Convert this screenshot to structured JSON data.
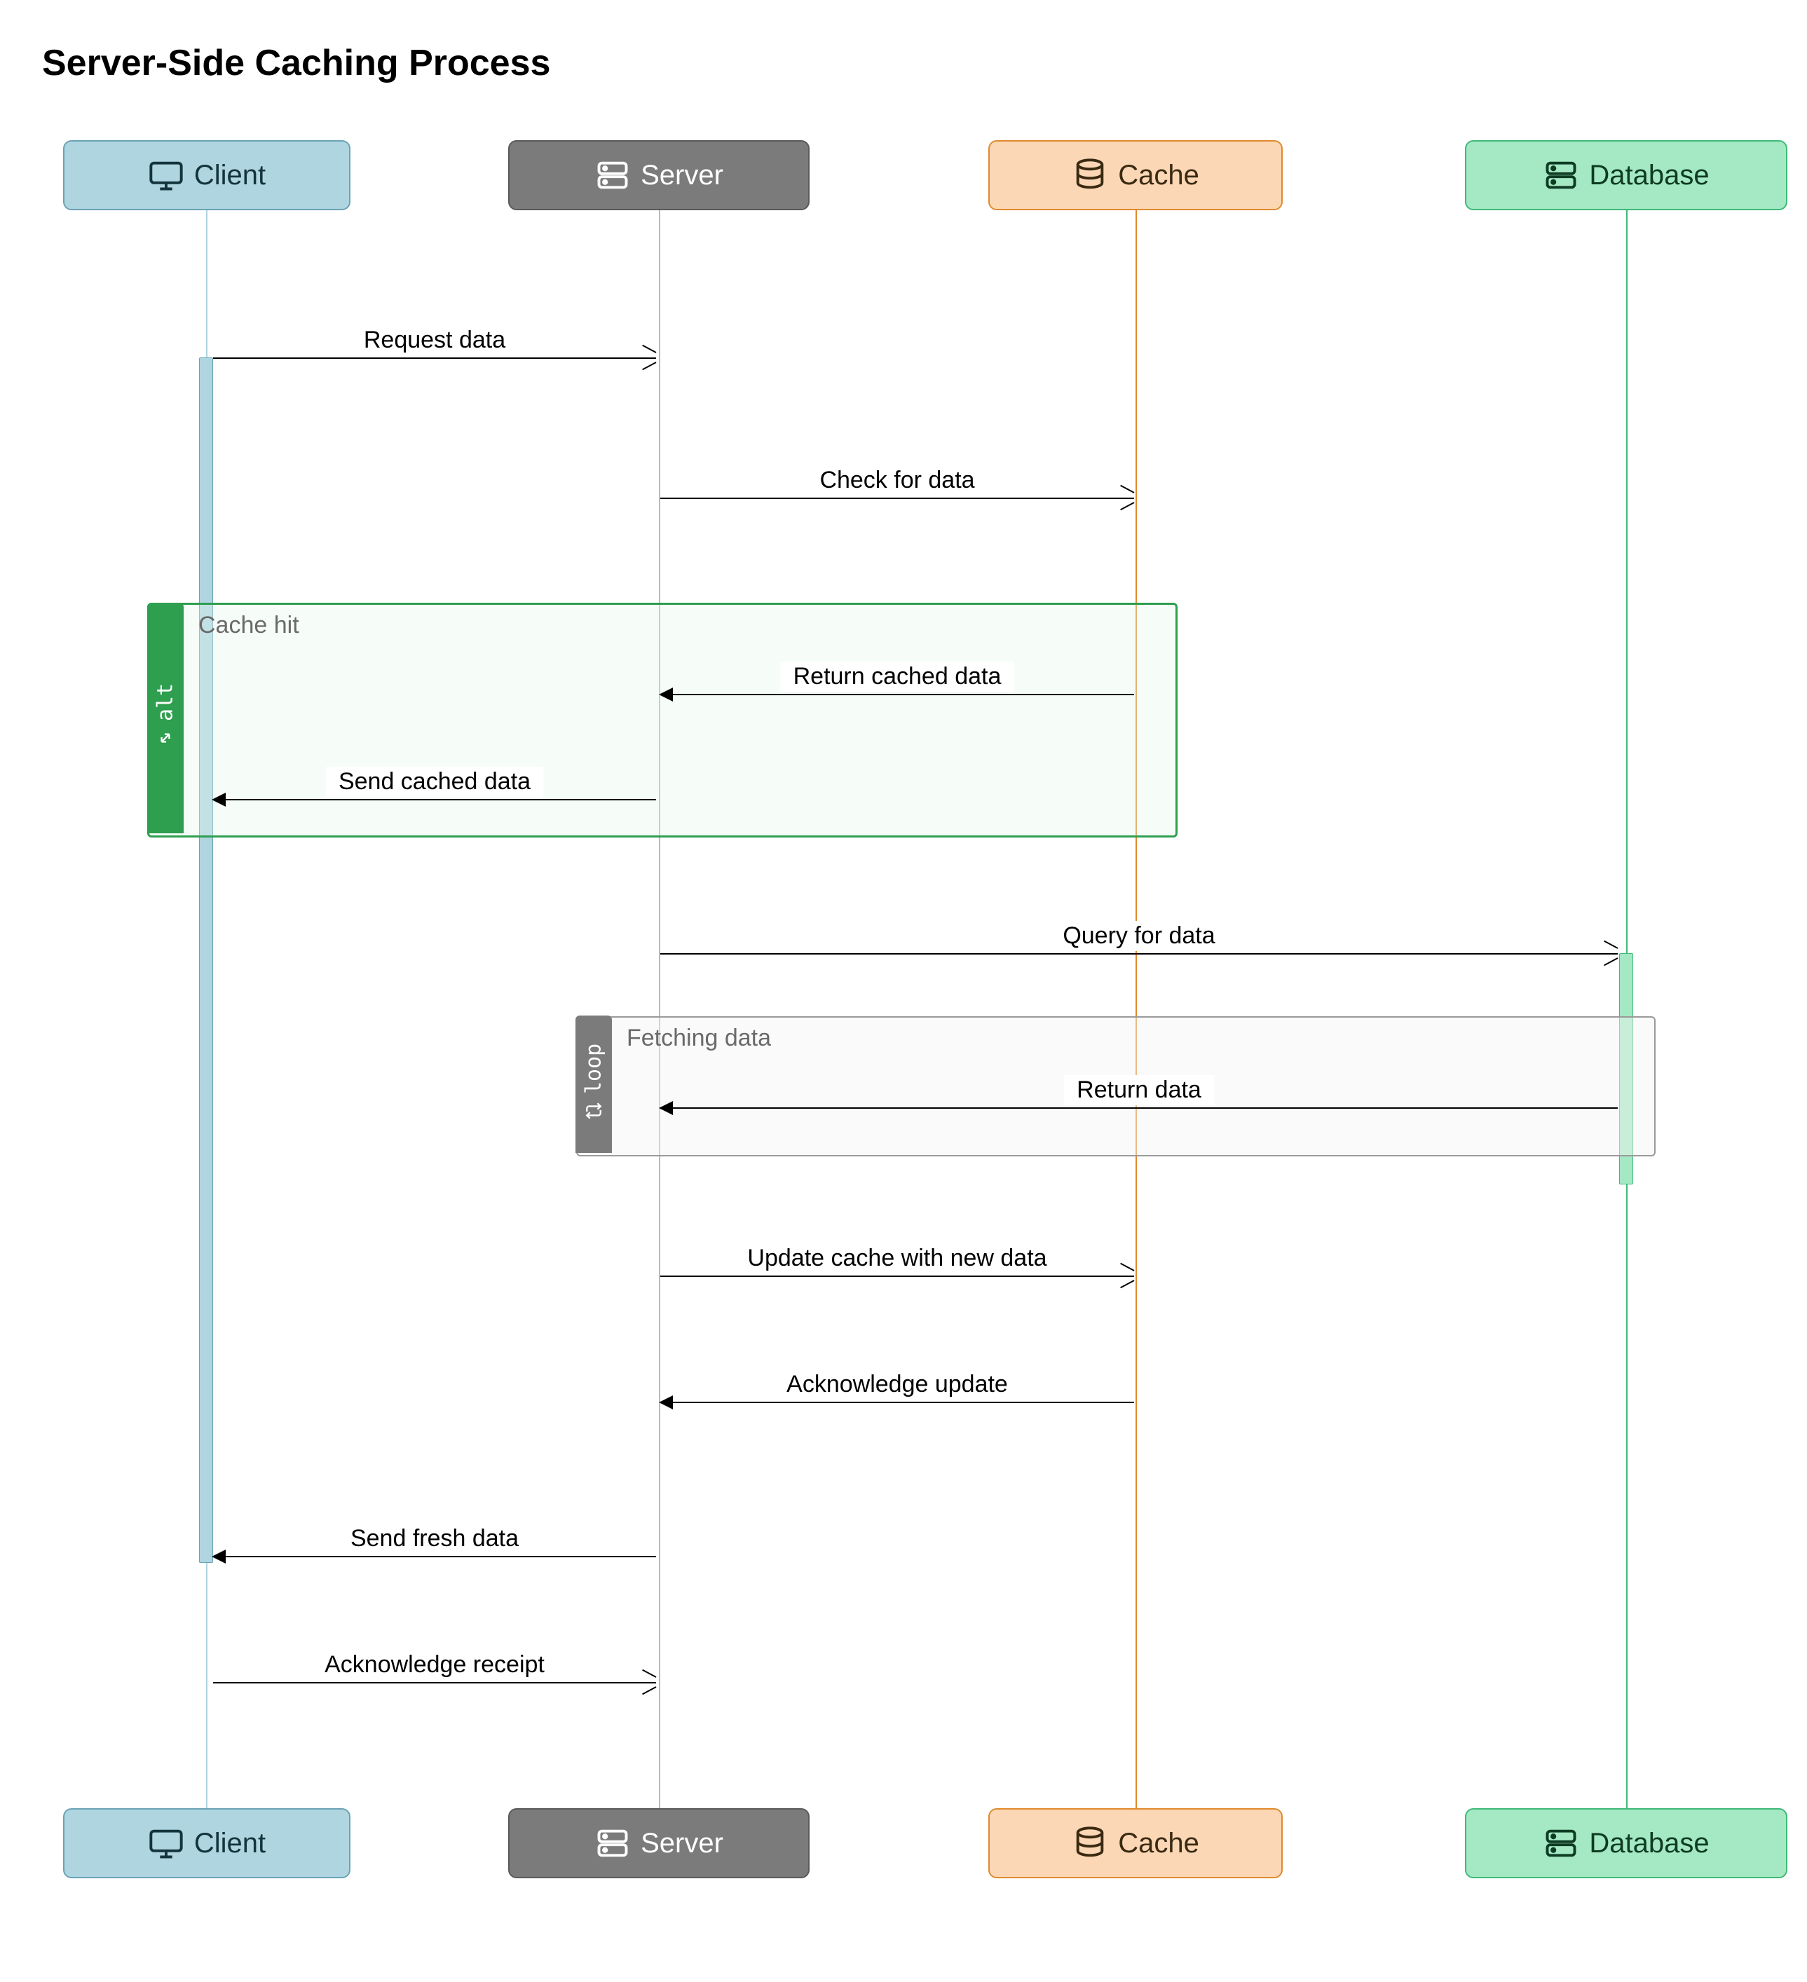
{
  "title": "Server-Side Caching Process",
  "participants": {
    "client": {
      "label": "Client",
      "icon": "monitor"
    },
    "server": {
      "label": "Server",
      "icon": "server-rack"
    },
    "cache": {
      "label": "Cache",
      "icon": "database"
    },
    "database": {
      "label": "Database",
      "icon": "server-rack"
    }
  },
  "fragments": {
    "alt": {
      "tag": "alt",
      "condition": "Cache hit",
      "icon": "expand-arrows"
    },
    "loop": {
      "tag": "loop",
      "condition": "Fetching data",
      "icon": "loop-arrows"
    }
  },
  "messages": {
    "m1": {
      "from": "client",
      "to": "server",
      "text": "Request data",
      "style": "open"
    },
    "m2": {
      "from": "server",
      "to": "cache",
      "text": "Check for data",
      "style": "open"
    },
    "m3": {
      "from": "cache",
      "to": "server",
      "text": "Return cached data",
      "style": "solid"
    },
    "m4": {
      "from": "server",
      "to": "client",
      "text": "Send cached data",
      "style": "solid"
    },
    "m5": {
      "from": "server",
      "to": "database",
      "text": "Query for data",
      "style": "open"
    },
    "m6": {
      "from": "database",
      "to": "server",
      "text": "Return data",
      "style": "solid"
    },
    "m7": {
      "from": "server",
      "to": "cache",
      "text": "Update cache with new data",
      "style": "open"
    },
    "m8": {
      "from": "cache",
      "to": "server",
      "text": "Acknowledge update",
      "style": "solid"
    },
    "m9": {
      "from": "server",
      "to": "client",
      "text": "Send fresh data",
      "style": "solid"
    },
    "m10": {
      "from": "client",
      "to": "server",
      "text": "Acknowledge receipt",
      "style": "open"
    }
  },
  "chart_data": {
    "type": "sequence-diagram",
    "title": "Server-Side Caching Process",
    "participants": [
      "Client",
      "Server",
      "Cache",
      "Database"
    ],
    "interactions": [
      {
        "from": "Client",
        "to": "Server",
        "label": "Request data"
      },
      {
        "from": "Server",
        "to": "Cache",
        "label": "Check for data"
      },
      {
        "fragment": "alt",
        "condition": "Cache hit",
        "messages": [
          {
            "from": "Cache",
            "to": "Server",
            "label": "Return cached data"
          },
          {
            "from": "Server",
            "to": "Client",
            "label": "Send cached data"
          }
        ]
      },
      {
        "from": "Server",
        "to": "Database",
        "label": "Query for data"
      },
      {
        "fragment": "loop",
        "condition": "Fetching data",
        "messages": [
          {
            "from": "Database",
            "to": "Server",
            "label": "Return data"
          }
        ]
      },
      {
        "from": "Server",
        "to": "Cache",
        "label": "Update cache with new data"
      },
      {
        "from": "Cache",
        "to": "Server",
        "label": "Acknowledge update"
      },
      {
        "from": "Server",
        "to": "Client",
        "label": "Send fresh data"
      },
      {
        "from": "Client",
        "to": "Server",
        "label": "Acknowledge receipt"
      }
    ]
  }
}
